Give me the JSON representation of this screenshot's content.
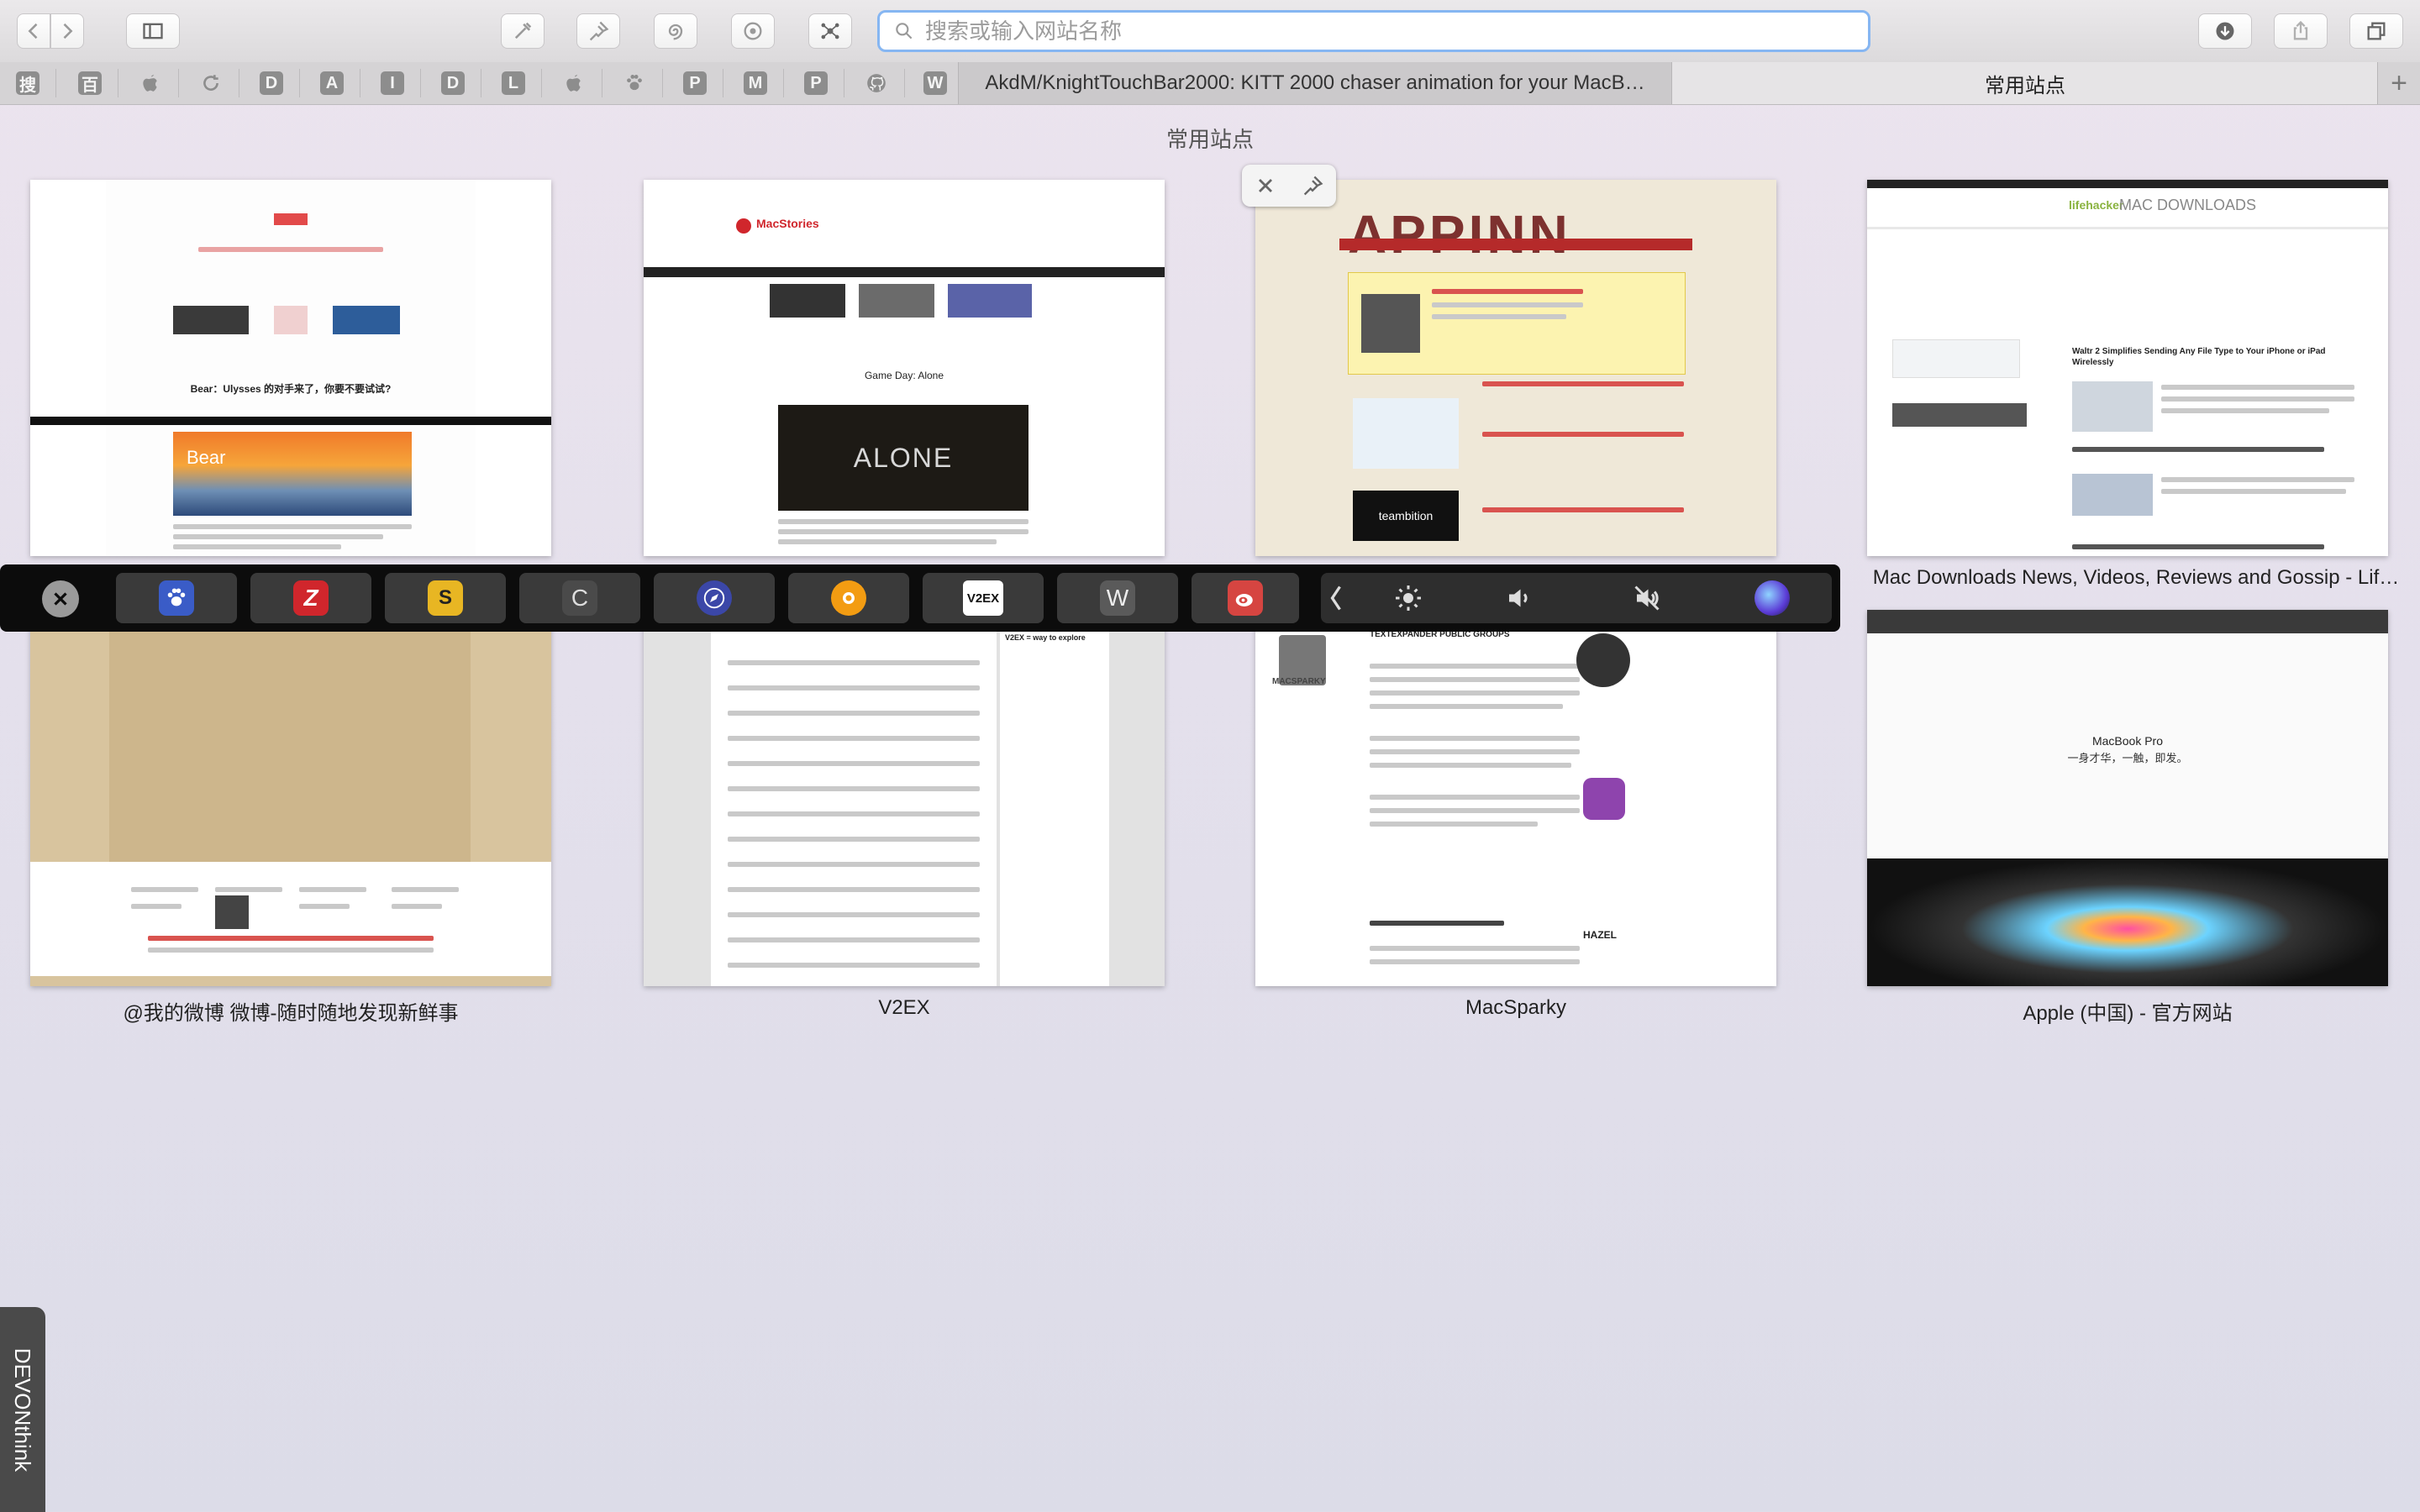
{
  "toolbar": {
    "search_placeholder": "搜索或输入网站名称",
    "buttons": [
      "back-icon",
      "forward-icon",
      "sidebar-icon",
      "extension-icon",
      "pin-icon",
      "spiral-icon",
      "palette-icon",
      "network-icon",
      "download-icon",
      "share-icon",
      "tabs-overview-icon"
    ]
  },
  "favorites": [
    "搜",
    "百",
    "apple-icon",
    "refresh-icon",
    "D",
    "A",
    "I",
    "D",
    "L",
    "apple-icon",
    "paw-icon",
    "P",
    "M",
    "P",
    "github-icon",
    "W"
  ],
  "tabs": [
    {
      "label": "AkdM/KnightTouchBar2000: KITT 2000 chaser animation for your MacB…",
      "active": false
    },
    {
      "label": "常用站点",
      "active": true
    }
  ],
  "top_sites": {
    "heading": "常用站点",
    "sites": [
      {
        "title": "",
        "thumb_text": [
          "Bear：Ulysses 的对手来了，你要不要试试?",
          "Bear"
        ]
      },
      {
        "title": "",
        "thumb_text": [
          "MacStories",
          "Game Day: Alone",
          "ALONE"
        ]
      },
      {
        "title": "",
        "thumb_text": [
          "APPINN",
          "teambition"
        ]
      },
      {
        "title": "Mac Downloads News, Videos, Reviews and Gossip - Lif…",
        "thumb_text": [
          "lifehacker",
          "MAC DOWNLOADS",
          "Waltr 2 Simplifies Sending Any File Type to Your iPhone or iPad Wirelessly"
        ]
      },
      {
        "title": "@我的微博 微博-随时随地发现新鲜事",
        "thumb_text": []
      },
      {
        "title": "V2EX",
        "thumb_text": [
          "V2EX = way to explore"
        ]
      },
      {
        "title": "MacSparky",
        "thumb_text": [
          "TEXTEXPANDER PUBLIC GROUPS",
          "MACSPARKY",
          "HAZEL"
        ]
      },
      {
        "title": "Apple (中国) - 官方网站",
        "thumb_text": [
          "MacBook Pro",
          "一身才华，一触，即发。"
        ]
      }
    ]
  },
  "touch_bar": {
    "apps": [
      {
        "name": "baidu",
        "color": "#3a5cc7",
        "glyph": "",
        "icon": "paw-icon"
      },
      {
        "name": "zhihu-daily",
        "color": "#d0262c",
        "glyph": "",
        "icon": "z-logo-icon"
      },
      {
        "name": "sspai",
        "color": "#e8b623",
        "glyph": "S",
        "icon": "s-logo-icon"
      },
      {
        "name": "c-site",
        "color": "#4a4a4a",
        "glyph": "C",
        "icon": "c-letter-icon"
      },
      {
        "name": "safari-like",
        "color": "#3b47a8",
        "glyph": "",
        "icon": "compass-icon"
      },
      {
        "name": "orange-app",
        "color": "#f39c12",
        "glyph": "",
        "icon": "sun-logo-icon"
      },
      {
        "name": "v2ex",
        "color": "#ffffff",
        "glyph": "V2EX",
        "icon": "v2ex-logo-icon"
      },
      {
        "name": "wikipedia",
        "color": "#5a5a5a",
        "glyph": "W",
        "icon": "w-letter-icon"
      },
      {
        "name": "weibo",
        "color": "#d64541",
        "glyph": "",
        "icon": "weibo-icon"
      }
    ],
    "controls": [
      "chevron-left-icon",
      "brightness-icon",
      "volume-icon",
      "mute-icon",
      "siri-icon"
    ]
  },
  "dock": {
    "label": "DEVONthink"
  },
  "colors": {
    "accent_focus": "#86b6f2",
    "background": "#e6e0ec",
    "touchbar": "#0c0c0c"
  }
}
